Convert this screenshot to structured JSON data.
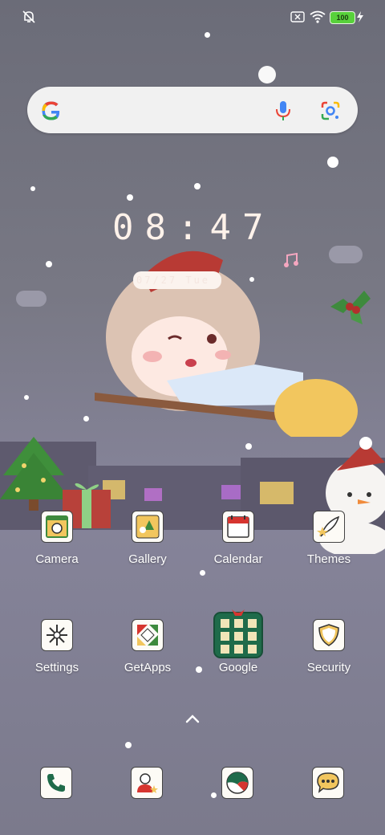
{
  "status_bar": {
    "icons": [
      "notifications-off-icon",
      "no-sim-icon",
      "wifi-icon",
      "charging-icon"
    ],
    "battery_level": "100"
  },
  "search": {
    "logo": "google-g-icon",
    "mic": "mic-icon",
    "lens": "lens-icon"
  },
  "clock": {
    "time": "08:47",
    "date": "07/27 Tue"
  },
  "apps_row1": [
    {
      "label": "Camera",
      "icon": "camera-icon"
    },
    {
      "label": "Gallery",
      "icon": "gallery-icon"
    },
    {
      "label": "Calendar",
      "icon": "calendar-icon"
    },
    {
      "label": "Themes",
      "icon": "themes-icon"
    }
  ],
  "apps_row2": [
    {
      "label": "Settings",
      "icon": "settings-icon"
    },
    {
      "label": "GetApps",
      "icon": "getapps-icon"
    },
    {
      "label": "Google",
      "icon": "google-folder-icon"
    },
    {
      "label": "Security",
      "icon": "security-icon"
    }
  ],
  "dock": [
    {
      "icon": "phone-icon"
    },
    {
      "icon": "contacts-icon"
    },
    {
      "icon": "browser-icon"
    },
    {
      "icon": "messages-icon"
    }
  ],
  "colors": {
    "background_top": "#6b6c78",
    "searchbar": "#f1f1f1",
    "battery": "#58d13b",
    "santa_hat": "#b83a34"
  }
}
